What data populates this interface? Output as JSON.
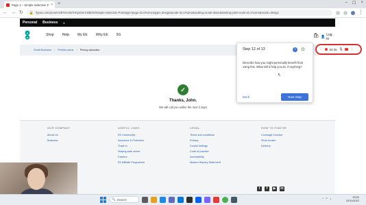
{
  "browser": {
    "tab_title": "Page 1 – Simple Selection Proto...",
    "url": "figma.com/proto/VZEFmnnB7HKptGmYsBb/IH/Simple-Selection-Prototype?page-id=0%3A1&type=design&node-id=1%3A2&scaling=scale-down&starting-point-node-id=1%3A2&mode=design",
    "new_tab": "+"
  },
  "site": {
    "personal": "Personal",
    "business": "Business",
    "nav": [
      "Shop",
      "Help",
      "My EE",
      "Why EE",
      "5G"
    ],
    "login": "Log in",
    "breadcrumbs": [
      "Small Business",
      "Flexible plans",
      "Pricing calculator"
    ]
  },
  "thanks": {
    "title": "Thanks, John.",
    "message": "We will call you within the next 2 days"
  },
  "footer": {
    "columns": [
      {
        "head": "OUR COMPANY",
        "links": [
          "About Us",
          "Business"
        ]
      },
      {
        "head": "USEFUL LINKS",
        "links": [
          "EE Community",
          "Insurance & Protection",
          "Trade in",
          "Staying safe online",
          "Careers",
          "EE Affiliate Programme"
        ]
      },
      {
        "head": "LEGAL",
        "links": [
          "Terms and conditions",
          "Privacy",
          "Cookie settings",
          "Code of practice",
          "Accessibility",
          "Modern Slavery Statement"
        ]
      },
      {
        "head": "HOW TO FIND EE",
        "links": [
          "Coverage Checker",
          "Store locator",
          "Delivery"
        ]
      }
    ]
  },
  "step": {
    "title": "Step 12 of 13",
    "body": "Describe how you might personally benefit from using this. What will it help you do, if anything?",
    "back": "Back",
    "next": "Next Step"
  },
  "recording": {
    "timer": "00:35"
  },
  "taskbar": {
    "search": "Search",
    "time": "13:00",
    "date": "22/11/2023"
  },
  "colors": {
    "ee_black": "#0b0b0b",
    "accent_blue": "#3b73d9",
    "success_green": "#2e7d32",
    "record_red": "#d32f2f"
  }
}
